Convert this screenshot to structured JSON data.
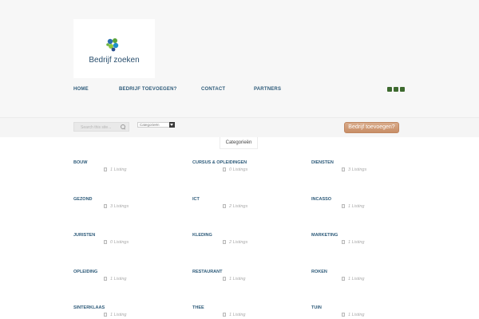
{
  "header": {
    "logo_text": "Bedrijf zoeken",
    "nav": [
      {
        "label": "HOME"
      },
      {
        "label": "BEDRIJF TOEVOEGEN?"
      },
      {
        "label": "CONTACT"
      },
      {
        "label": "PARTNERS"
      }
    ],
    "social": [
      {
        "icon": "twitter-icon",
        "color": "#3e6a2f"
      },
      {
        "icon": "rss-icon",
        "color": "#3e6a2f"
      },
      {
        "icon": "facebook-icon",
        "color": "#3e6a2f"
      }
    ]
  },
  "toolbar": {
    "search_placeholder": "Search this site...",
    "category_select": "Categorieën",
    "cta_label": "Bedrijf toevoegen?"
  },
  "tab_label": "Categorieën",
  "categories": [
    {
      "name": "BOUW",
      "count": "1 Listing"
    },
    {
      "name": "CURSUS & OPLEIDINGEN",
      "count": "0 Listings"
    },
    {
      "name": "DIENSTEN",
      "count": "3 Listings"
    },
    {
      "name": "GEZOND",
      "count": "3 Listings"
    },
    {
      "name": "ICT",
      "count": "2 Listings"
    },
    {
      "name": "INCASSO",
      "count": "1 Listing"
    },
    {
      "name": "JURISTEN",
      "count": "0 Listings"
    },
    {
      "name": "KLEDING",
      "count": "2 Listings"
    },
    {
      "name": "MARKETING",
      "count": "1 Listing"
    },
    {
      "name": "OPLEIDING",
      "count": "1 Listing"
    },
    {
      "name": "RESTAURANT",
      "count": "1 Listing"
    },
    {
      "name": "ROKEN",
      "count": "1 Listing"
    },
    {
      "name": "SINTERKLAAS",
      "count": "1 Listing"
    },
    {
      "name": "THEE",
      "count": "1 Listing"
    },
    {
      "name": "TUIN",
      "count": "1 Listing"
    }
  ]
}
